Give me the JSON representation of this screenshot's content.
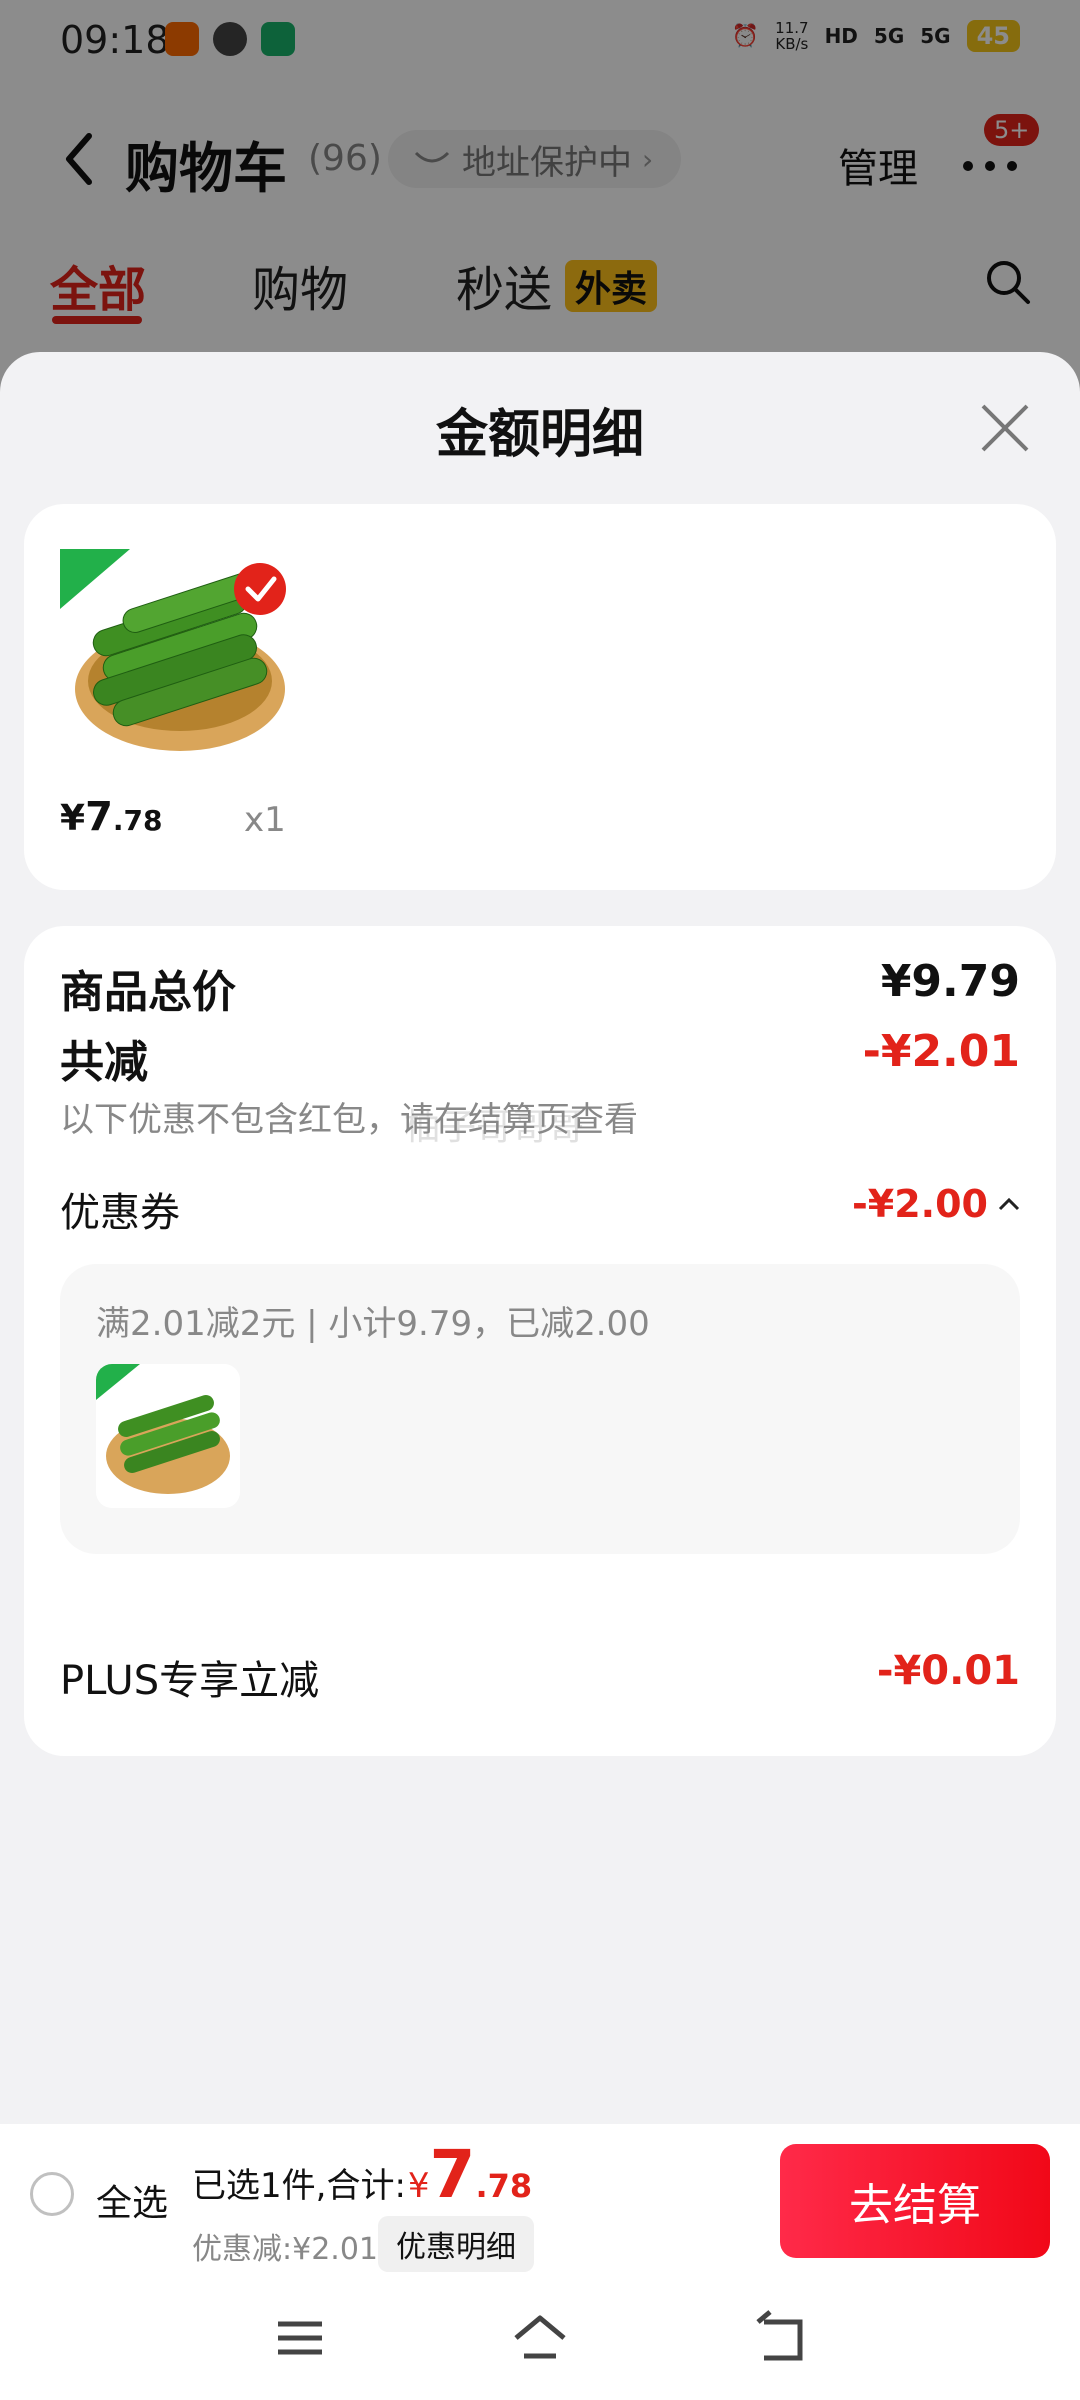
{
  "status_bar": {
    "time": "09:18",
    "net_speed_value": "11.7",
    "net_speed_unit": "KB/s",
    "hd_label": "HD",
    "signal1": "5G",
    "signal2": "5G",
    "battery": "45"
  },
  "cart_header": {
    "title": "购物车",
    "count": "(96)",
    "address_label": "地址保护中",
    "manage_label": "管理",
    "badge": "5+"
  },
  "tabs": [
    {
      "label": "全部"
    },
    {
      "label": "购物"
    },
    {
      "label": "秒送"
    }
  ],
  "tab_badge": "外卖",
  "sheet": {
    "title": "金额明细",
    "product": {
      "price_currency": "¥",
      "price_int": "7",
      "price_dec": ".78",
      "qty": "x1"
    },
    "rows": {
      "total_label": "商品总价",
      "total_value": "¥9.79",
      "reduce_label": "共减",
      "reduce_value": "-¥2.01",
      "note": "以下优惠不包含红包，请在结算页查看",
      "watermark": "柚子哥哥哥",
      "coupon_label": "优惠券",
      "coupon_value": "-¥2.00",
      "coupon_desc": "满2.01减2元 | 小计9.79，已减2.00",
      "plus_label": "PLUS专享立减",
      "plus_value": "-¥0.01"
    }
  },
  "checkout": {
    "select_all": "全选",
    "summary_prefix": "已选1件,合计:",
    "currency": "¥",
    "amount_int": "7",
    "amount_dec": ".78",
    "discount": "优惠减:¥2.01",
    "detail_button": "优惠明细",
    "checkout_button": "去结算"
  },
  "colors": {
    "accent_red": "#e2231a",
    "badge_yellow": "#ffc21a"
  }
}
